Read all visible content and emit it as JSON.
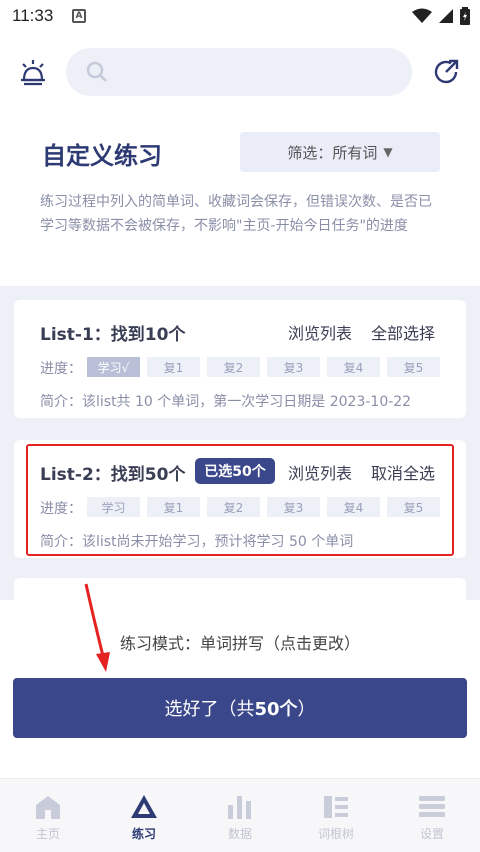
{
  "status": {
    "time": "11:33",
    "notification_glyph": "A"
  },
  "search": {
    "placeholder": ""
  },
  "header": {
    "title": "自定义练习",
    "filter_label": "筛选：所有词",
    "filter_caret": "▼",
    "description": "练习过程中列入的简单词、收藏词会保存，但错误次数、是否已学习等数据不会被保存，不影响\"主页-开始今日任务\"的进度"
  },
  "lists": [
    {
      "title": "List-1：找到10个",
      "selected_badge": "",
      "browse_label": "浏览列表",
      "select_label": "全部选择",
      "progress_label": "进度：",
      "stages": [
        "学习√",
        "复1",
        "复2",
        "复3",
        "复4",
        "复5"
      ],
      "completed_stages": 1,
      "intro": "简介：该list共 10 个单词，第一次学习日期是 2023-10-22"
    },
    {
      "title": "List-2：找到50个",
      "selected_badge": "已选50个",
      "browse_label": "浏览列表",
      "select_label": "取消全选",
      "progress_label": "进度：",
      "stages": [
        "学习",
        "复1",
        "复2",
        "复3",
        "复4",
        "复5"
      ],
      "completed_stages": 0,
      "intro": "简介：该list尚未开始学习，预计将学习 50 个单词"
    }
  ],
  "mode": {
    "text": "练习模式：单词拼写（点击更改）"
  },
  "confirm": {
    "label": "选好了（共50个）"
  },
  "tabs": [
    {
      "label": "主页",
      "icon": "home-icon",
      "active": false
    },
    {
      "label": "练习",
      "icon": "practice-icon",
      "active": true
    },
    {
      "label": "数据",
      "icon": "stats-icon",
      "active": false
    },
    {
      "label": "词根树",
      "icon": "tree-icon",
      "active": false
    },
    {
      "label": "设置",
      "icon": "settings-icon",
      "active": false
    }
  ],
  "colors": {
    "accent": "#3a478a",
    "title": "#2e3a74",
    "highlight": "#e52222",
    "panel_bg": "#eef0f8"
  }
}
